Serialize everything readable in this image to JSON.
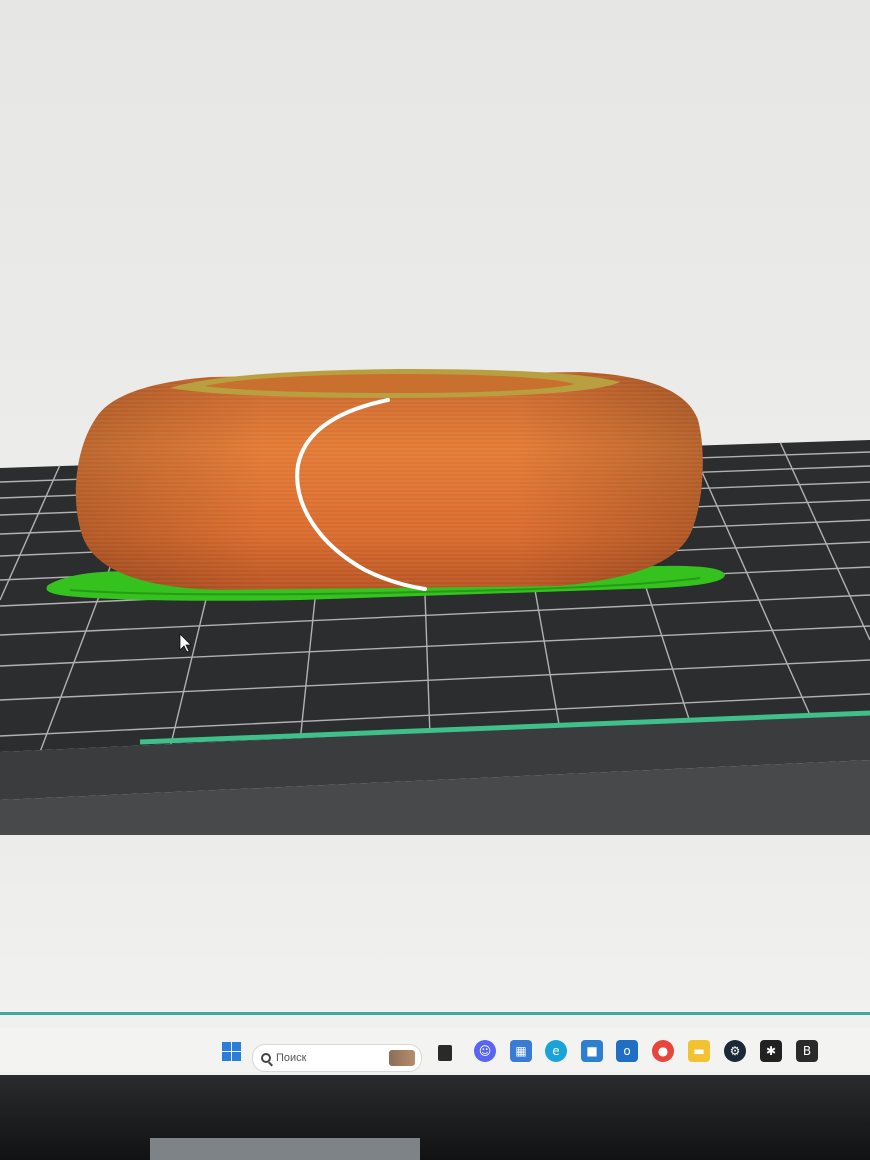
{
  "app": {
    "name": "3D slicer preview"
  },
  "viewport": {
    "model": {
      "body_color": "#d9692e",
      "rim_color": "#b8a040",
      "seam_color": "#ffffff",
      "brim_color": "#35c21f"
    },
    "build_plate": {
      "plate_color": "#2b2d2f",
      "grid_color": "#c9c9c9",
      "edge_color": "#3fbf8a"
    }
  },
  "taskbar": {
    "search": {
      "placeholder": "Поиск"
    },
    "accent_color": "#3fa9a0",
    "icons": [
      {
        "name": "windows-start-icon"
      },
      {
        "name": "search-icon"
      },
      {
        "name": "widget-icon"
      },
      {
        "name": "task-view-icon"
      },
      {
        "name": "discord-icon",
        "color": "#5865f2"
      },
      {
        "name": "store-icon",
        "color": "#3a7bd5"
      },
      {
        "name": "edge-icon",
        "color": "#1aa3d9"
      },
      {
        "name": "app-store-icon",
        "color": "#2f7fd1"
      },
      {
        "name": "outlook-icon",
        "color": "#1f6fc5"
      },
      {
        "name": "chrome-icon",
        "color": "#e8453c"
      },
      {
        "name": "file-explorer-icon",
        "color": "#f2c230"
      },
      {
        "name": "steam-icon",
        "color": "#1b2838"
      },
      {
        "name": "slicer-app-icon",
        "color": "#222222"
      },
      {
        "name": "bambu-icon",
        "color": "#2a2a2a"
      }
    ]
  }
}
